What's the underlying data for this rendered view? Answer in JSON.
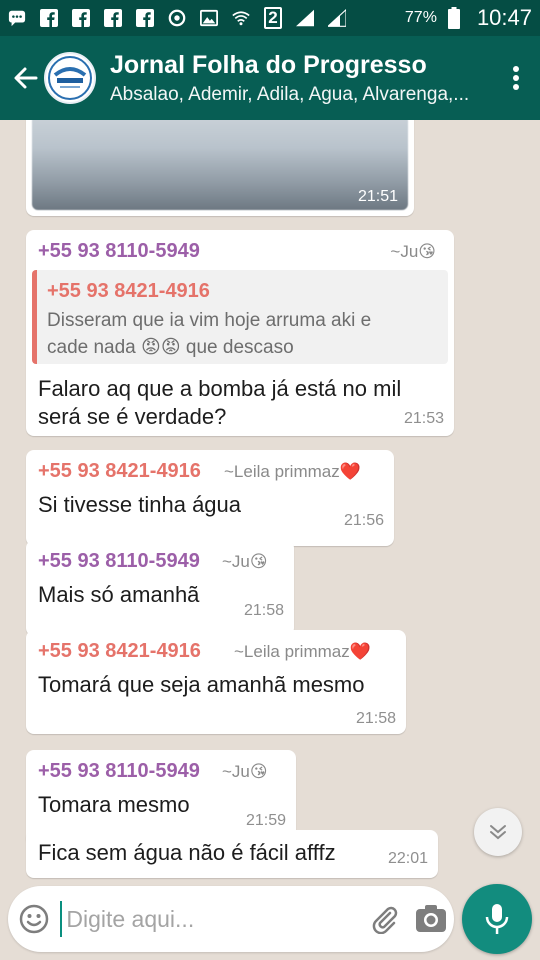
{
  "status_bar": {
    "left_icons": [
      "chat-bubble-icon",
      "facebook-icon",
      "facebook-icon",
      "facebook-icon",
      "facebook-icon",
      "sync-icon",
      "image-icon",
      "wifi-icon",
      "sim2-icon",
      "signal-icon",
      "signal-icon"
    ],
    "sim_label": "2",
    "battery": "77%",
    "time": "10:47"
  },
  "header": {
    "title": "Jornal Folha do Progresso",
    "subtitle": "Absalao, Ademir, Adila, Agua, Alvarenga,..."
  },
  "messages": [
    {
      "type": "image",
      "time": "21:51"
    },
    {
      "sender": "+55 93 8110-5949",
      "alias": "~Ju😘",
      "quote": {
        "sender": "+55 93 8421-4916",
        "text_line1": "Disseram que ia vim hoje arruma aki e",
        "text_line2": "cade nada 😡😡 que descaso"
      },
      "text_line1": "Falaro aq que a bomba já está no mil",
      "text_line2": "será se é verdade?",
      "time": "21:53"
    },
    {
      "sender": "+55 93 8421-4916",
      "alias": "~Leila primmaz❤️",
      "text": "Si tivesse tinha água",
      "time": "21:56"
    },
    {
      "sender": "+55 93 8110-5949",
      "alias": "~Ju😘",
      "text": "Mais só amanhã",
      "time": "21:58"
    },
    {
      "sender": "+55 93 8421-4916",
      "alias": "~Leila primmaz❤️",
      "text": "Tomará que seja amanhã mesmo",
      "time": "21:58"
    },
    {
      "sender": "+55 93 8110-5949",
      "alias": "~Ju😘",
      "text": "Tomara mesmo",
      "time": "21:59"
    },
    {
      "text": "Fica sem água não é fácil afffz",
      "time": "22:01"
    }
  ],
  "input": {
    "placeholder": "Digite aqui..."
  },
  "colors": {
    "header": "#075e54",
    "status": "#054d44",
    "accent": "#128c7e",
    "sender_a": "#9c5fa8",
    "sender_b": "#e5736a"
  }
}
